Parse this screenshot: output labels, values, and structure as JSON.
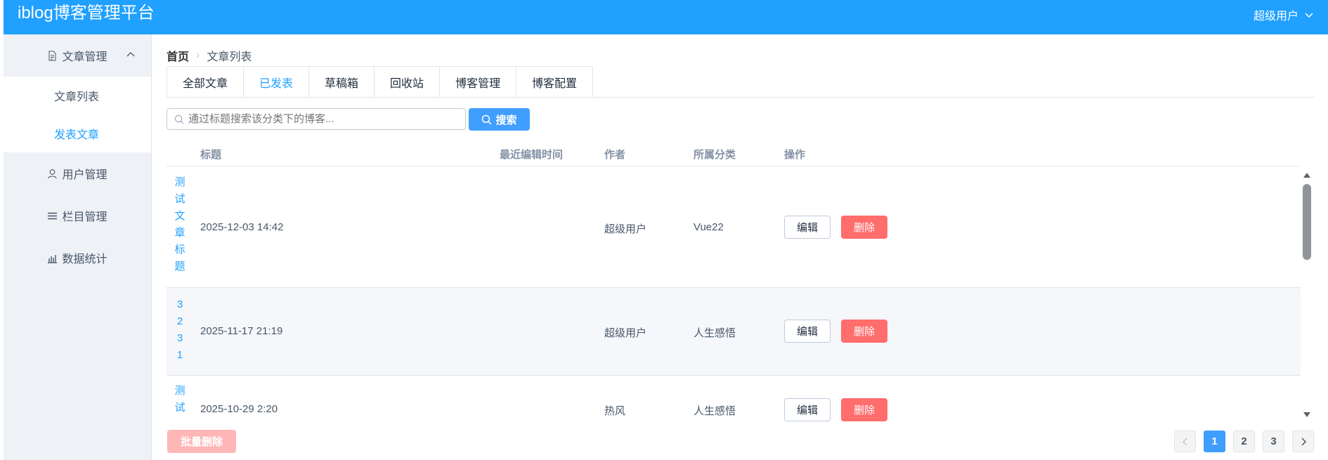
{
  "header": {
    "brand": "iblog博客管理平台",
    "user": "超级用户"
  },
  "sidebar": {
    "articles": "文章管理",
    "sub": [
      {
        "label": "文章列表"
      },
      {
        "label": "发表文章"
      }
    ],
    "users": "用户管理",
    "columns": "栏目管理",
    "stats": "数据统计"
  },
  "breadcrumb": {
    "home": "首页",
    "current": "文章列表"
  },
  "tabs": [
    {
      "label": "全部文章"
    },
    {
      "label": "已发表"
    },
    {
      "label": "草稿箱"
    },
    {
      "label": "回收站"
    },
    {
      "label": "博客管理"
    },
    {
      "label": "博客配置"
    }
  ],
  "search": {
    "placeholder": "通过标题搜索该分类下的博客...",
    "button": "搜索"
  },
  "table": {
    "headers": {
      "title": "标题",
      "edited": "最近编辑时间",
      "author": "作者",
      "category": "所属分类",
      "actions": "操作"
    },
    "rows": [
      {
        "title": "测试文章标题",
        "time": "2025-12-03 14:42",
        "author": "超级用户",
        "category": "Vue22"
      },
      {
        "title": "3231",
        "time": "2025-11-17 21:19",
        "author": "超级用户",
        "category": "人生感悟"
      },
      {
        "title": "测试",
        "time": "2025-10-29 2:20",
        "author": "热风",
        "category": "人生感悟"
      }
    ],
    "edit_label": "编辑",
    "delete_label": "删除"
  },
  "batch_delete": "批量删除",
  "pagination": {
    "pages": [
      "1",
      "2",
      "3"
    ],
    "current": "1"
  }
}
